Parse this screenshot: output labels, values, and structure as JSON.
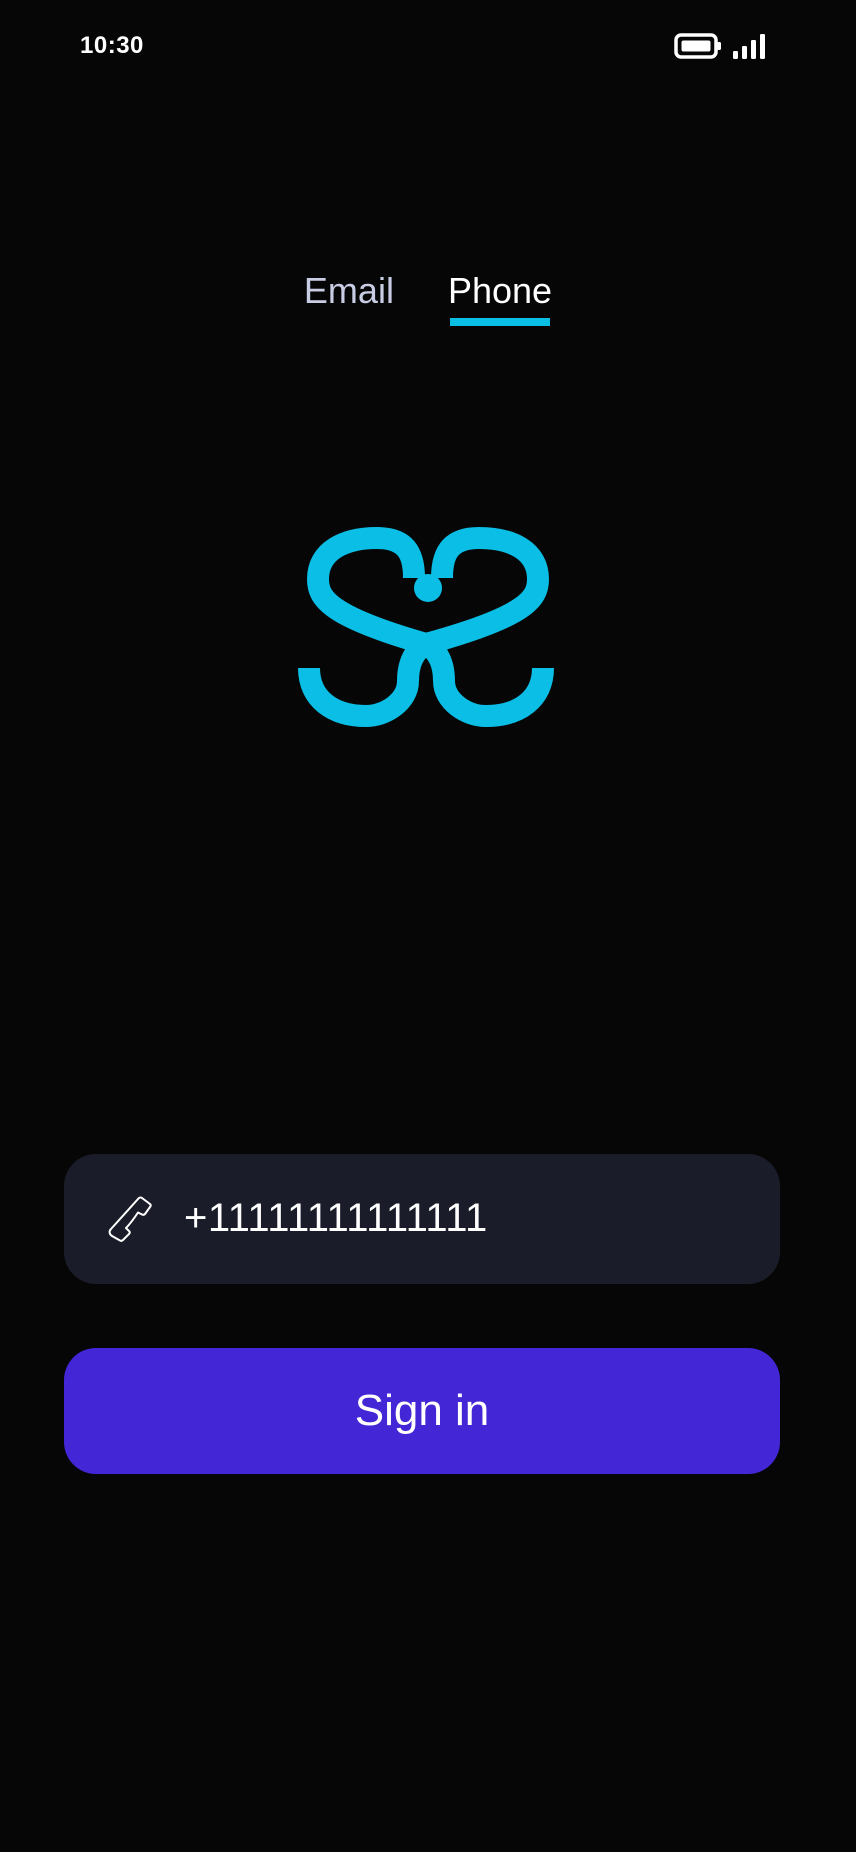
{
  "status_bar": {
    "time": "10:30",
    "icons": [
      "battery-full-icon",
      "signal-icon"
    ]
  },
  "tabs": [
    {
      "label": "Email",
      "active": false
    },
    {
      "label": "Phone",
      "active": true
    }
  ],
  "logo": {
    "icon": "app-logo",
    "color": "#0bbee5"
  },
  "phone_field": {
    "icon": "phone-icon",
    "value": "+11111111111111"
  },
  "signin_button": {
    "label": "Sign in",
    "color": "#4327d6"
  },
  "colors": {
    "background": "#060607",
    "accent": "#0bbee5",
    "field_background": "#1a1c29",
    "primary_button": "#4327d6"
  }
}
